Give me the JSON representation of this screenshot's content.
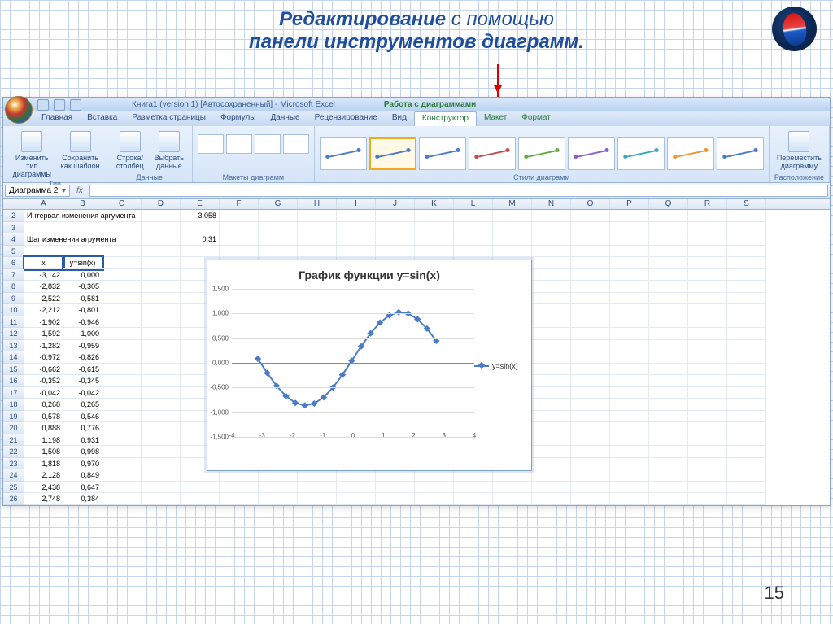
{
  "slide": {
    "title_bold": "Редактирование",
    "title_rest": " с помощью",
    "title_line2": "панели инструментов диаграмм.",
    "page_num": "15"
  },
  "excel": {
    "file_title": "Книга1 (version 1) [Автосохраненный] - Microsoft Excel",
    "context_title": "Работа с диаграммами",
    "tabs": [
      "Главная",
      "Вставка",
      "Разметка страницы",
      "Формулы",
      "Данные",
      "Рецензирование",
      "Вид"
    ],
    "ctx_tabs": [
      "Конструктор",
      "Макет",
      "Формат"
    ],
    "active_ctx_tab": "Конструктор",
    "ribbon_groups": {
      "type": {
        "label": "Тип",
        "btns": [
          "Изменить тип диаграммы",
          "Сохранить как шаблон"
        ]
      },
      "data": {
        "label": "Данные",
        "btns": [
          "Строка/столбец",
          "Выбрать данные"
        ]
      },
      "layouts": {
        "label": "Макеты диаграмм"
      },
      "styles": {
        "label": "Стили диаграмм"
      },
      "location": {
        "label": "Расположение",
        "btn": "Переместить диаграмму"
      }
    },
    "namebox": "Диаграмма 2",
    "columns": [
      "A",
      "B",
      "C",
      "D",
      "E",
      "F",
      "G",
      "H",
      "I",
      "J",
      "K",
      "L",
      "M",
      "N",
      "O",
      "P",
      "Q",
      "R",
      "S"
    ],
    "rows": {
      "2": {
        "A": "Интервал изменения аргумента",
        "E": "3,058"
      },
      "4": {
        "A": "Шаг изменения агрумента",
        "E": "0,31"
      },
      "6": {
        "A": "x",
        "B": "y=sin(x)"
      },
      "7": {
        "A": "-3,142",
        "B": "0,000"
      },
      "8": {
        "A": "-2,832",
        "B": "-0,305"
      },
      "9": {
        "A": "-2,522",
        "B": "-0,581"
      },
      "10": {
        "A": "-2,212",
        "B": "-0,801"
      },
      "11": {
        "A": "-1,902",
        "B": "-0,946"
      },
      "12": {
        "A": "-1,592",
        "B": "-1,000"
      },
      "13": {
        "A": "-1,282",
        "B": "-0,959"
      },
      "14": {
        "A": "-0,972",
        "B": "-0,826"
      },
      "15": {
        "A": "-0,662",
        "B": "-0,615"
      },
      "16": {
        "A": "-0,352",
        "B": "-0,345"
      },
      "17": {
        "A": "-0,042",
        "B": "-0,042"
      },
      "18": {
        "A": "0,268",
        "B": "0,265"
      },
      "19": {
        "A": "0,578",
        "B": "0,546"
      },
      "20": {
        "A": "0,888",
        "B": "0,776"
      },
      "21": {
        "A": "1,198",
        "B": "0,931"
      },
      "22": {
        "A": "1,508",
        "B": "0,998"
      },
      "23": {
        "A": "1,818",
        "B": "0,970"
      },
      "24": {
        "A": "2,128",
        "B": "0,849"
      },
      "25": {
        "A": "2,438",
        "B": "0,647"
      },
      "26": {
        "A": "2,748",
        "B": "0,384"
      }
    },
    "row_order": [
      "2",
      "3",
      "4",
      "5",
      "6",
      "7",
      "8",
      "9",
      "10",
      "11",
      "12",
      "13",
      "14",
      "15",
      "16",
      "17",
      "18",
      "19",
      "20",
      "21",
      "22",
      "23",
      "24",
      "25",
      "26"
    ],
    "style_colors": [
      "#4a7ac8",
      "#4a7ac8",
      "#4a7ac8",
      "#c84a4a",
      "#68a848",
      "#8860c8",
      "#3aa8b8",
      "#e89830",
      "#4a7ac8"
    ]
  },
  "chart_data": {
    "type": "line",
    "title": "График функции y=sin(x)",
    "series": [
      {
        "name": "y=sin(x)",
        "x": [
          -3.142,
          -2.832,
          -2.522,
          -2.212,
          -1.902,
          -1.592,
          -1.282,
          -0.972,
          -0.662,
          -0.352,
          -0.042,
          0.268,
          0.578,
          0.888,
          1.198,
          1.508,
          1.818,
          2.128,
          2.438,
          2.748
        ],
        "y": [
          0.0,
          -0.305,
          -0.581,
          -0.801,
          -0.946,
          -1.0,
          -0.959,
          -0.826,
          -0.615,
          -0.345,
          -0.042,
          0.265,
          0.546,
          0.776,
          0.931,
          0.998,
          0.97,
          0.849,
          0.647,
          0.384
        ]
      }
    ],
    "xlim": [
      -4,
      4
    ],
    "ylim": [
      -1.5,
      1.5
    ],
    "xticks": [
      -4,
      -3,
      -2,
      -1,
      0,
      1,
      2,
      3,
      4
    ],
    "yticks": [
      -1.5,
      -1.0,
      -0.5,
      0.0,
      0.5,
      1.0,
      1.5
    ],
    "ytick_labels": [
      "-1,500",
      "-1,000",
      "-0,500",
      "0,000",
      "0,500",
      "1,000",
      "1,500"
    ]
  }
}
